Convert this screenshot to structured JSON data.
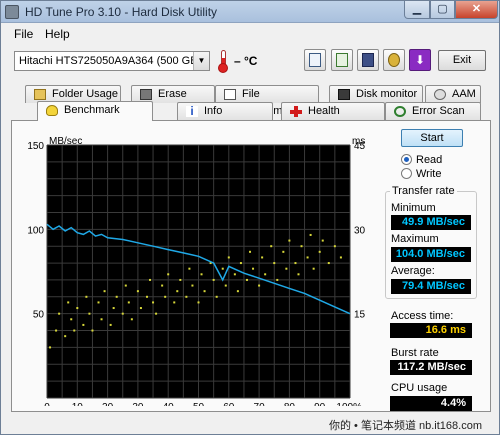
{
  "window": {
    "title": "HD Tune Pro 3.10 - Hard Disk Utility",
    "close_glyph": "✕",
    "min_glyph": "▁",
    "max_glyph": "▢"
  },
  "menu": {
    "file": "File",
    "help": "Help"
  },
  "toolbar": {
    "drive": "Hitachi HTS725050A9A364 (500 GB)",
    "temperature": "– °C",
    "exit_label": "Exit",
    "download_glyph": "⬇"
  },
  "tabs_top": [
    "Folder Usage",
    "Erase",
    "File Benchmark",
    "Disk monitor",
    "AAM"
  ],
  "tabs_bottom": [
    "Benchmark",
    "Info",
    "Health",
    "Error Scan"
  ],
  "controls": {
    "start_label": "Start",
    "read_label": "Read",
    "write_label": "Write",
    "mode": "read"
  },
  "transfer_rate": {
    "title": "Transfer rate",
    "minimum_label": "Minimum",
    "minimum": "49.9 MB/sec",
    "maximum_label": "Maximum",
    "maximum": "104.0 MB/sec",
    "average_label": "Average:",
    "average": "79.4 MB/sec"
  },
  "stats": {
    "access_label": "Access time:",
    "access": "16.6 ms",
    "burst_label": "Burst rate",
    "burst": "117.2 MB/sec",
    "cpu_label": "CPU usage",
    "cpu": "4.4%"
  },
  "watermark": "你的 • 笔记本频道 nb.it168.com",
  "colors": {
    "plot_bg": "#000000",
    "grid": "#3a3a3a",
    "transfer_line": "#1fa8e6",
    "access_points": "#d8d83a",
    "value_cyan": "#00c6ff",
    "value_yellow": "#ffd200"
  },
  "chart_data": {
    "type": "line",
    "ylabel_left": "MB/sec",
    "ylabel_right": "ms",
    "ylim_left": [
      0,
      150
    ],
    "ylim_right": [
      0,
      45
    ],
    "yticks_left": [
      50,
      100,
      150
    ],
    "yticks_right": [
      15,
      30,
      45
    ],
    "xticks": [
      "0",
      "10",
      "20",
      "30",
      "40",
      "50",
      "60",
      "70",
      "80",
      "90",
      "100%"
    ],
    "xlim": [
      0,
      100
    ],
    "grid": true,
    "series": [
      {
        "type": "line",
        "x": [
          0,
          2,
          4,
          6,
          8,
          10,
          12,
          14,
          16,
          18,
          20,
          25,
          30,
          35,
          40,
          45,
          50,
          55,
          58,
          60,
          65,
          70,
          75,
          80,
          85,
          90,
          95,
          100
        ],
        "y": [
          103,
          100,
          102,
          99,
          101,
          98,
          97,
          99,
          96,
          97,
          95,
          94,
          92,
          90,
          88,
          86,
          84,
          80,
          70,
          78,
          74,
          71,
          68,
          65,
          62,
          58,
          54,
          50
        ]
      },
      {
        "type": "scatter",
        "x": [
          1,
          3,
          4,
          6,
          7,
          8,
          9,
          10,
          12,
          13,
          14,
          15,
          17,
          18,
          19,
          21,
          22,
          23,
          25,
          26,
          27,
          28,
          30,
          31,
          33,
          34,
          35,
          36,
          38,
          39,
          40,
          42,
          43,
          44,
          46,
          47,
          48,
          50,
          51,
          52,
          54,
          55,
          56,
          58,
          59,
          60,
          62,
          63,
          64,
          66,
          67,
          68,
          70,
          71,
          72,
          74,
          75,
          76,
          78,
          79,
          80,
          82,
          83,
          84,
          86,
          87,
          88,
          90,
          91,
          93,
          95,
          97
        ],
        "y": [
          9,
          12,
          15,
          11,
          17,
          14,
          12,
          16,
          13,
          18,
          15,
          12,
          17,
          14,
          19,
          13,
          16,
          18,
          15,
          20,
          17,
          14,
          19,
          16,
          18,
          21,
          17,
          15,
          20,
          18,
          22,
          17,
          19,
          21,
          18,
          23,
          20,
          17,
          22,
          19,
          24,
          21,
          18,
          23,
          20,
          25,
          22,
          19,
          24,
          21,
          26,
          23,
          20,
          25,
          22,
          27,
          24,
          21,
          26,
          23,
          28,
          24,
          22,
          27,
          25,
          29,
          23,
          26,
          28,
          24,
          27,
          25
        ]
      }
    ]
  }
}
